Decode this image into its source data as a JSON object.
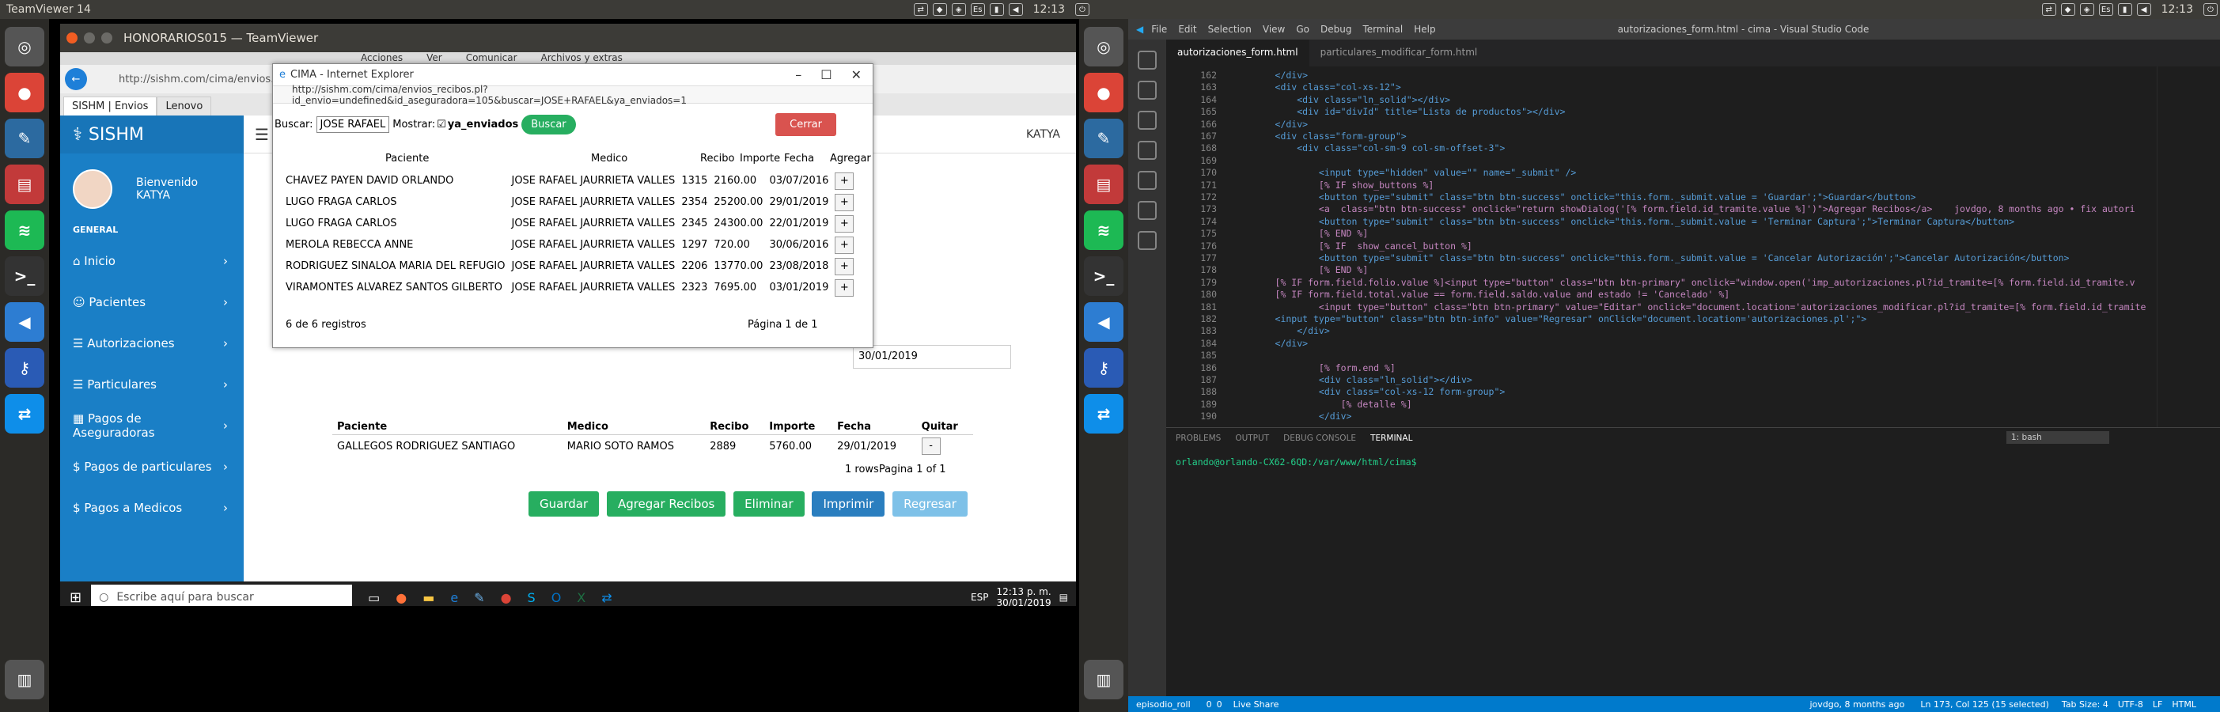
{
  "left_topbar": {
    "app_name": "TeamViewer 14",
    "clock": "12:13"
  },
  "right_topbar": {
    "clock": "12:13"
  },
  "teamviewer": {
    "window_title": "HONORARIOS015 — TeamViewer",
    "toolbar": [
      "Acciones",
      "Ver",
      "Comunicar",
      "Archivos y extras"
    ]
  },
  "browser": {
    "url": "http://sishm.com/cima/envios.pl",
    "tab1": "SISHM | Envios",
    "tab2": "Lenovo"
  },
  "sishm": {
    "brand": "SISHM",
    "welcome": "Bienvenido",
    "user": "KATYA",
    "section": "GENERAL",
    "menu": [
      "Inicio",
      "Pacientes",
      "Autorizaciones",
      "Particulares",
      "Pagos de Aseguradoras",
      "Pagos de particulares",
      "Pagos a Medicos"
    ],
    "topnav_user": "KATYA",
    "date_field": "30/01/2019",
    "table": {
      "headers": [
        "Paciente",
        "Medico",
        "Recibo",
        "Importe",
        "Fecha",
        "Quitar"
      ],
      "rows": [
        [
          "GALLEGOS RODRIGUEZ SANTIAGO",
          "MARIO SOTO RAMOS",
          "2889",
          "5760.00",
          "29/01/2019",
          "-"
        ]
      ],
      "footer": "1 rowsPagina 1 of 1"
    },
    "buttons": [
      "Guardar",
      "Agregar Recibos",
      "Eliminar",
      "Imprimir",
      "Regresar"
    ]
  },
  "popup": {
    "title": "CIMA - Internet Explorer",
    "url": "http://sishm.com/cima/envios_recibos.pl?id_envio=undefined&id_aseguradora=105&buscar=JOSE+RAFAEL&ya_enviados=1",
    "search_label": "Buscar:",
    "search_value": "JOSE RAFAEL",
    "show_label": "Mostrar:",
    "checkbox_label": "ya_enviados",
    "search_button": "Buscar",
    "close_button": "Cerrar",
    "headers": [
      "Paciente",
      "Medico",
      "Recibo",
      "Importe",
      "Fecha",
      "Agregar"
    ],
    "rows": [
      [
        "CHAVEZ PAYEN DAVID ORLANDO",
        "JOSE RAFAEL JAURRIETA VALLES",
        "1315",
        "2160.00",
        "03/07/2016",
        "+"
      ],
      [
        "LUGO FRAGA CARLOS",
        "JOSE RAFAEL JAURRIETA VALLES",
        "2354",
        "25200.00",
        "29/01/2019",
        "+"
      ],
      [
        "LUGO FRAGA CARLOS",
        "JOSE RAFAEL JAURRIETA VALLES",
        "2345",
        "24300.00",
        "22/01/2019",
        "+"
      ],
      [
        "MEROLA REBECCA ANNE",
        "JOSE RAFAEL JAURRIETA VALLES",
        "1297",
        "720.00",
        "30/06/2016",
        "+"
      ],
      [
        "RODRIGUEZ SINALOA MARIA DEL REFUGIO",
        "JOSE RAFAEL JAURRIETA VALLES",
        "2206",
        "13770.00",
        "23/08/2018",
        "+"
      ],
      [
        "VIRAMONTES ALVAREZ SANTOS GILBERTO",
        "JOSE RAFAEL JAURRIETA VALLES",
        "2323",
        "7695.00",
        "03/01/2019",
        "+"
      ]
    ],
    "records": "6 de 6 registros",
    "page": "Página 1 de 1"
  },
  "windows_taskbar": {
    "search_placeholder": "Escribe aquí para buscar",
    "lang": "ESP",
    "time": "12:13 p. m.",
    "date": "30/01/2019"
  },
  "vscode": {
    "window_title": "autorizaciones_form.html - cima - Visual Studio Code",
    "menu": [
      "File",
      "Edit",
      "Selection",
      "View",
      "Go",
      "Debug",
      "Terminal",
      "Help"
    ],
    "tabs": [
      "autorizaciones_form.html",
      "particulares_modificar_form.html"
    ],
    "code_lines": [
      {
        "n": "162",
        "t": "      </div>"
      },
      {
        "n": "163",
        "t": "      <div class=\"col-xs-12\">"
      },
      {
        "n": "164",
        "t": "          <div class=\"ln_solid\"></div>"
      },
      {
        "n": "165",
        "t": "          <div id=\"divId\" title=\"Lista de productos\"></div>"
      },
      {
        "n": "166",
        "t": "      </div>"
      },
      {
        "n": "167",
        "t": "      <div class=\"form-group\">"
      },
      {
        "n": "168",
        "t": "          <div class=\"col-sm-9 col-sm-offset-3\">"
      },
      {
        "n": "169",
        "t": ""
      },
      {
        "n": "170",
        "t": "              <input type=\"hidden\" value=\"\" name=\"_submit\" />"
      },
      {
        "n": "171",
        "t": "              [% IF show_buttons %]"
      },
      {
        "n": "172",
        "t": "              <button type=\"submit\" class=\"btn btn-success\" onclick=\"this.form._submit.value = 'Guardar';\">Guardar</button>"
      },
      {
        "n": "173",
        "t": "              <a  class=\"btn btn-success\" onclick=\"return showDialog('[% form.field.id_tramite.value %]')\">Agregar Recibos</a>    jovdgo, 8 months ago • fix autori"
      },
      {
        "n": "174",
        "t": "              <button type=\"submit\" class=\"btn btn-success\" onclick=\"this.form._submit.value = 'Terminar Captura';\">Terminar Captura</button>"
      },
      {
        "n": "175",
        "t": "              [% END %]"
      },
      {
        "n": "176",
        "t": "              [% IF  show_cancel_button %]"
      },
      {
        "n": "177",
        "t": "              <button type=\"submit\" class=\"btn btn-success\" onclick=\"this.form._submit.value = 'Cancelar Autorización';\">Cancelar Autorización</button>"
      },
      {
        "n": "178",
        "t": "              [% END %]"
      },
      {
        "n": "179",
        "t": "      [% IF form.field.folio.value %]<input type=\"button\" class=\"btn btn-primary\" onclick=\"window.open('imp_autorizaciones.pl?id_tramite=[% form.field.id_tramite.v"
      },
      {
        "n": "180",
        "t": "      [% IF form.field.total.value == form.field.saldo.value and estado != 'Cancelado' %]"
      },
      {
        "n": "181",
        "t": "              <input type=\"button\" class=\"btn btn-primary\" value=\"Editar\" onclick=\"document.location='autorizaciones_modificar.pl?id_tramite=[% form.field.id_tramite"
      },
      {
        "n": "182",
        "t": "      <input type=\"button\" class=\"btn btn-info\" value=\"Regresar\" onClick=\"document.location='autorizaciones.pl';\">"
      },
      {
        "n": "183",
        "t": "          </div>"
      },
      {
        "n": "184",
        "t": "      </div>"
      },
      {
        "n": "185",
        "t": ""
      },
      {
        "n": "186",
        "t": "              [% form.end %]"
      },
      {
        "n": "187",
        "t": "              <div class=\"ln_solid\"></div>"
      },
      {
        "n": "188",
        "t": "              <div class=\"col-xs-12 form-group\">"
      },
      {
        "n": "189",
        "t": "                  [% detalle %]"
      },
      {
        "n": "190",
        "t": "              </div>"
      }
    ],
    "panel_tabs": [
      "PROBLEMS",
      "OUTPUT",
      "DEBUG CONSOLE",
      "TERMINAL"
    ],
    "terminal_select": "1: bash",
    "terminal_prompt": "orlando@orlando-CX62-6QD:/var/www/html/cima$",
    "status": {
      "branch": "episodio_roll",
      "errors": "0",
      "warnings": "0",
      "share": "Live Share",
      "blame": "jovdgo, 8 months ago",
      "position": "Ln 173, Col 125 (15 selected)",
      "tab": "Tab Size: 4",
      "enc": "UTF-8",
      "eol": "LF",
      "lang": "HTML"
    }
  }
}
